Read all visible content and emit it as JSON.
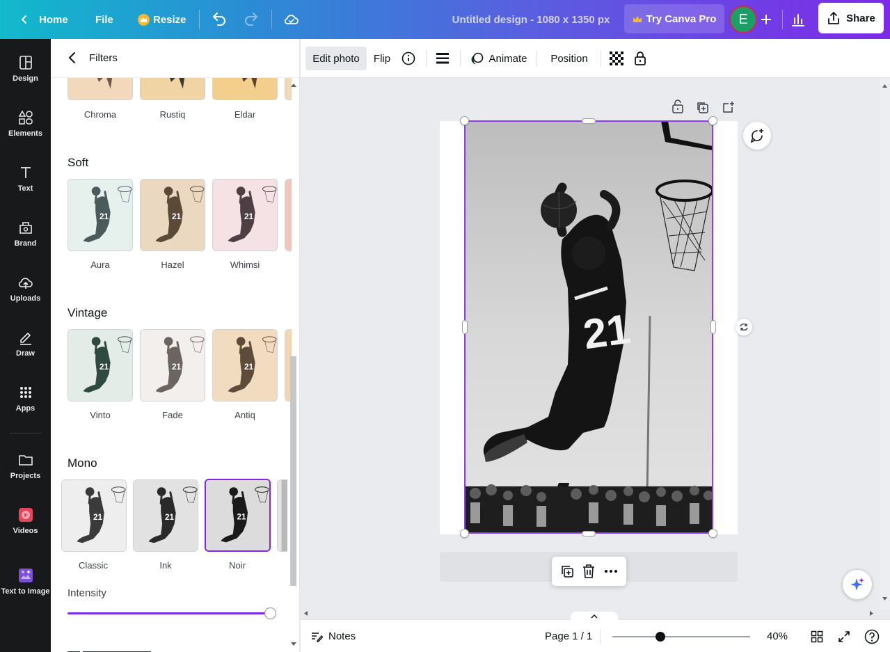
{
  "topbar": {
    "home_label": "Home",
    "file_label": "File",
    "resize_label": "Resize",
    "design_title": "Untitled design - 1080 x 1350 px",
    "try_pro_label": "Try Canva Pro",
    "avatar_initial": "E",
    "share_label": "Share"
  },
  "rail": {
    "items": [
      {
        "label": "Design",
        "icon": "layout-icon"
      },
      {
        "label": "Elements",
        "icon": "shapes-icon"
      },
      {
        "label": "Text",
        "icon": "text-icon"
      },
      {
        "label": "Brand",
        "icon": "brand-icon"
      },
      {
        "label": "Uploads",
        "icon": "cloud-upload-icon"
      },
      {
        "label": "Draw",
        "icon": "pen-icon"
      },
      {
        "label": "Apps",
        "icon": "grid-icon"
      },
      {
        "label": "Projects",
        "icon": "folder-icon"
      },
      {
        "label": "Videos",
        "icon": "video-icon"
      },
      {
        "label": "Text to Image",
        "icon": "image-ai-icon"
      }
    ]
  },
  "panel": {
    "title": "Filters",
    "partial_row": [
      "Chroma",
      "Rustiq",
      "Eldar"
    ],
    "sections": [
      {
        "title": "Soft",
        "filters": [
          "Aura",
          "Hazel",
          "Whimsi"
        ]
      },
      {
        "title": "Vintage",
        "filters": [
          "Vinto",
          "Fade",
          "Antiq"
        ]
      },
      {
        "title": "Mono",
        "filters": [
          "Classic",
          "Ink",
          "Noir"
        ]
      }
    ],
    "selected_filter": "Noir",
    "intensity_label": "Intensity",
    "intensity_value": 1.0,
    "accent_color": "#7d2ae8"
  },
  "context_toolbar": {
    "edit_photo_label": "Edit photo",
    "flip_label": "Flip",
    "animate_label": "Animate",
    "position_label": "Position"
  },
  "bottombar": {
    "notes_label": "Notes",
    "page_indicator": "Page 1 / 1",
    "zoom_level": "40%",
    "zoom_fraction": 0.35
  }
}
